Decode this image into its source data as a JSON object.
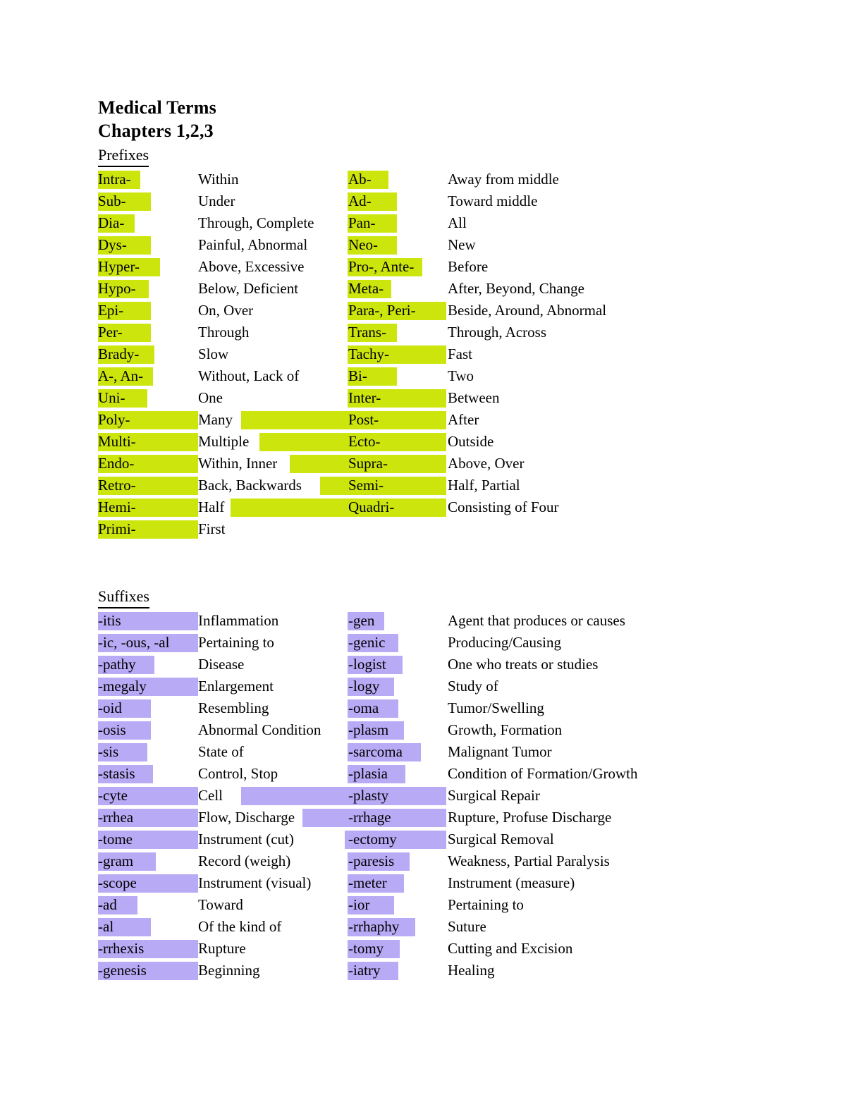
{
  "document": {
    "title": "Medical Terms",
    "subtitle": "Chapters 1,2,3"
  },
  "colors": {
    "prefix_highlight": "#CCE60D",
    "suffix_highlight": "#B9AAF5",
    "text": "#000000",
    "background": "#FFFFFF"
  },
  "sections": [
    {
      "heading": "Prefixes",
      "highlight": "#CCE60D",
      "rows": [
        {
          "term": "Intra-",
          "meaning": "Within",
          "term2": "Ab-",
          "meaning2": "Away from middle"
        },
        {
          "term": "Sub-",
          "meaning": "Under",
          "term2": "Ad-",
          "meaning2": "Toward middle"
        },
        {
          "term": "Dia-",
          "meaning": "Through, Complete",
          "term2": "Pan-",
          "meaning2": "All"
        },
        {
          "term": "Dys-",
          "meaning": "Painful, Abnormal",
          "term2": "Neo-",
          "meaning2": "New"
        },
        {
          "term": "Hyper-",
          "meaning": "Above, Excessive",
          "term2": "Pro-, Ante-",
          "meaning2": "Before"
        },
        {
          "term": "Hypo-",
          "meaning": "Below, Deficient",
          "term2": "Meta-",
          "meaning2": "After, Beyond, Change"
        },
        {
          "term": "Epi-",
          "meaning": "On, Over",
          "term2": "Para-, Peri-",
          "meaning2": "Beside, Around, Abnormal"
        },
        {
          "term": "Per-",
          "meaning": "Through",
          "term2": "Trans-",
          "meaning2": "Through, Across"
        },
        {
          "term": "Brady-",
          "meaning": "Slow",
          "term2": "Tachy-",
          "meaning2": "Fast"
        },
        {
          "term": "A-, An-",
          "meaning": "Without, Lack of",
          "term2": "Bi-",
          "meaning2": "Two"
        },
        {
          "term": "Uni-",
          "meaning": "One",
          "term2": "Inter-",
          "meaning2": "Between"
        },
        {
          "term": "Poly-",
          "meaning": "Many",
          "term2": "Post-",
          "meaning2": "After"
        },
        {
          "term": "Multi-",
          "meaning": "Multiple",
          "term2": "Ecto-",
          "meaning2": "Outside"
        },
        {
          "term": "Endo-",
          "meaning": "Within, Inner",
          "term2": "Supra-",
          "meaning2": "Above, Over"
        },
        {
          "term": "Retro-",
          "meaning": "Back, Backwards",
          "term2": "Semi-",
          "meaning2": "Half, Partial"
        },
        {
          "term": "Hemi-",
          "meaning": "Half",
          "term2": "Quadri-",
          "meaning2": "Consisting of Four"
        },
        {
          "term": "Primi-",
          "meaning": "First",
          "term2": "",
          "meaning2": ""
        }
      ]
    },
    {
      "heading": "Suffixes",
      "highlight": "#B9AAF5",
      "rows": [
        {
          "term": "-itis",
          "meaning": "Inflammation",
          "term2": "-gen",
          "meaning2": "Agent that produces or causes"
        },
        {
          "term": "-ic, -ous, -al",
          "meaning": "Pertaining to",
          "term2": "-genic",
          "meaning2": "Producing/Causing"
        },
        {
          "term": "-pathy",
          "meaning": "Disease",
          "term2": "-logist",
          "meaning2": "One who treats or studies"
        },
        {
          "term": "-megaly",
          "meaning": "Enlargement",
          "term2": "-logy",
          "meaning2": "Study of"
        },
        {
          "term": "-oid",
          "meaning": "Resembling",
          "term2": "-oma",
          "meaning2": "Tumor/Swelling"
        },
        {
          "term": "-osis",
          "meaning": "Abnormal Condition",
          "term2": "-plasm",
          "meaning2": "Growth, Formation"
        },
        {
          "term": "-sis",
          "meaning": "State of",
          "term2": "-sarcoma",
          "meaning2": "Malignant Tumor"
        },
        {
          "term": "-stasis",
          "meaning": "Control, Stop",
          "term2": "-plasia",
          "meaning2": "Condition of Formation/Growth"
        },
        {
          "term": "-cyte",
          "meaning": "Cell",
          "term2": "-plasty",
          "meaning2": "Surgical Repair"
        },
        {
          "term": "-rrhea",
          "meaning": "Flow, Discharge",
          "term2": "-rrhage",
          "meaning2": "Rupture, Profuse Discharge"
        },
        {
          "term": "-tome",
          "meaning": "Instrument (cut)",
          "term2": "-ectomy",
          "meaning2": "Surgical Removal"
        },
        {
          "term": "-gram",
          "meaning": "Record (weigh)",
          "term2": "-paresis",
          "meaning2": "Weakness, Partial Paralysis"
        },
        {
          "term": "-scope",
          "meaning": "Instrument (visual)",
          "term2": "-meter",
          "meaning2": "Instrument (measure)"
        },
        {
          "term": "-ad",
          "meaning": "Toward",
          "term2": "-ior",
          "meaning2": "Pertaining to"
        },
        {
          "term": "-al",
          "meaning": "Of the kind of",
          "term2": "-rrhaphy",
          "meaning2": "Suture"
        },
        {
          "term": "-rrhexis",
          "meaning": "Rupture",
          "term2": "-tomy",
          "meaning2": "Cutting and Excision"
        },
        {
          "term": "-genesis",
          "meaning": "Beginning",
          "term2": "-iatry",
          "meaning2": "Healing"
        }
      ]
    }
  ],
  "highlight_bands": {
    "prefixes": [
      {
        "a": [
          0,
          60
        ],
        "b": [],
        "c": [
          354,
          58
        ],
        "d": []
      },
      {
        "a": [
          0,
          75
        ],
        "b": [],
        "c": [
          354,
          70
        ],
        "d": []
      },
      {
        "a": [
          0,
          52
        ],
        "b": [],
        "c": [
          354,
          70
        ],
        "d": []
      },
      {
        "a": [
          0,
          75
        ],
        "b": [],
        "c": [
          354,
          70
        ],
        "d": []
      },
      {
        "a": [
          0,
          88
        ],
        "b": [],
        "c": [
          354,
          106
        ],
        "d": []
      },
      {
        "a": [
          0,
          72
        ],
        "b": [],
        "c": [
          354,
          62
        ],
        "d": []
      },
      {
        "a": [
          0,
          75
        ],
        "b": [],
        "c": [
          354,
          140
        ],
        "d": []
      },
      {
        "a": [
          0,
          75
        ],
        "b": [],
        "c": [
          354,
          70
        ],
        "d": []
      },
      {
        "a": [
          0,
          80
        ],
        "b": [],
        "c": [
          354,
          140
        ],
        "d": []
      },
      {
        "a": [
          0,
          78
        ],
        "b": [],
        "c": [
          354,
          70
        ],
        "d": []
      },
      {
        "a": [
          0,
          70
        ],
        "b": [],
        "c": [
          354,
          140
        ],
        "d": []
      },
      {
        "a": [
          0,
          142
        ],
        "b": [
          203,
          152
        ],
        "c": [
          354,
          140
        ],
        "d": []
      },
      {
        "a": [
          0,
          142
        ],
        "b": [
          229,
          126
        ],
        "c": [
          350,
          144
        ],
        "d": []
      },
      {
        "a": [
          0,
          142
        ],
        "b": [
          272,
          83
        ],
        "c": [
          350,
          144
        ],
        "d": []
      },
      {
        "a": [
          0,
          142
        ],
        "b": [
          315,
          40
        ],
        "c": [
          350,
          144
        ],
        "d": []
      },
      {
        "a": [
          0,
          142
        ],
        "b": [
          188,
          167
        ],
        "c": [
          350,
          144
        ],
        "d": []
      },
      {
        "a": [
          0,
          142
        ],
        "b": [],
        "c": [],
        "d": []
      }
    ],
    "suffixes": [
      {
        "a": [
          0,
          142
        ],
        "b": [],
        "c": [
          354,
          52
        ],
        "d": []
      },
      {
        "a": [
          0,
          142
        ],
        "b": [],
        "c": [
          354,
          72
        ],
        "d": []
      },
      {
        "a": [
          0,
          80
        ],
        "b": [],
        "c": [
          354,
          78
        ],
        "d": []
      },
      {
        "a": [
          0,
          142
        ],
        "b": [],
        "c": [
          354,
          66
        ],
        "d": []
      },
      {
        "a": [
          0,
          75
        ],
        "b": [],
        "c": [
          354,
          72
        ],
        "d": []
      },
      {
        "a": [
          0,
          75
        ],
        "b": [],
        "c": [
          354,
          80
        ],
        "d": []
      },
      {
        "a": [
          0,
          70
        ],
        "b": [],
        "c": [
          354,
          104
        ],
        "d": []
      },
      {
        "a": [
          0,
          78
        ],
        "b": [],
        "c": [
          354,
          82
        ],
        "d": []
      },
      {
        "a": [
          0,
          142
        ],
        "b": [
          203,
          152
        ],
        "c": [
          350,
          144
        ],
        "d": []
      },
      {
        "a": [
          0,
          142
        ],
        "b": [
          290,
          65
        ],
        "c": [
          350,
          144
        ],
        "d": []
      },
      {
        "a": [
          0,
          142
        ],
        "b": [],
        "c": [
          350,
          144
        ],
        "d": []
      },
      {
        "a": [
          0,
          82
        ],
        "b": [],
        "c": [
          354,
          88
        ],
        "d": []
      },
      {
        "a": [
          0,
          142
        ],
        "b": [],
        "c": [
          354,
          80
        ],
        "d": []
      },
      {
        "a": [
          0,
          56
        ],
        "b": [],
        "c": [
          354,
          66
        ],
        "d": []
      },
      {
        "a": [
          0,
          75
        ],
        "b": [],
        "c": [
          354,
          96
        ],
        "d": []
      },
      {
        "a": [
          0,
          142
        ],
        "b": [],
        "c": [
          354,
          74
        ],
        "d": []
      },
      {
        "a": [
          0,
          142
        ],
        "b": [],
        "c": [
          354,
          72
        ],
        "d": []
      }
    ]
  }
}
